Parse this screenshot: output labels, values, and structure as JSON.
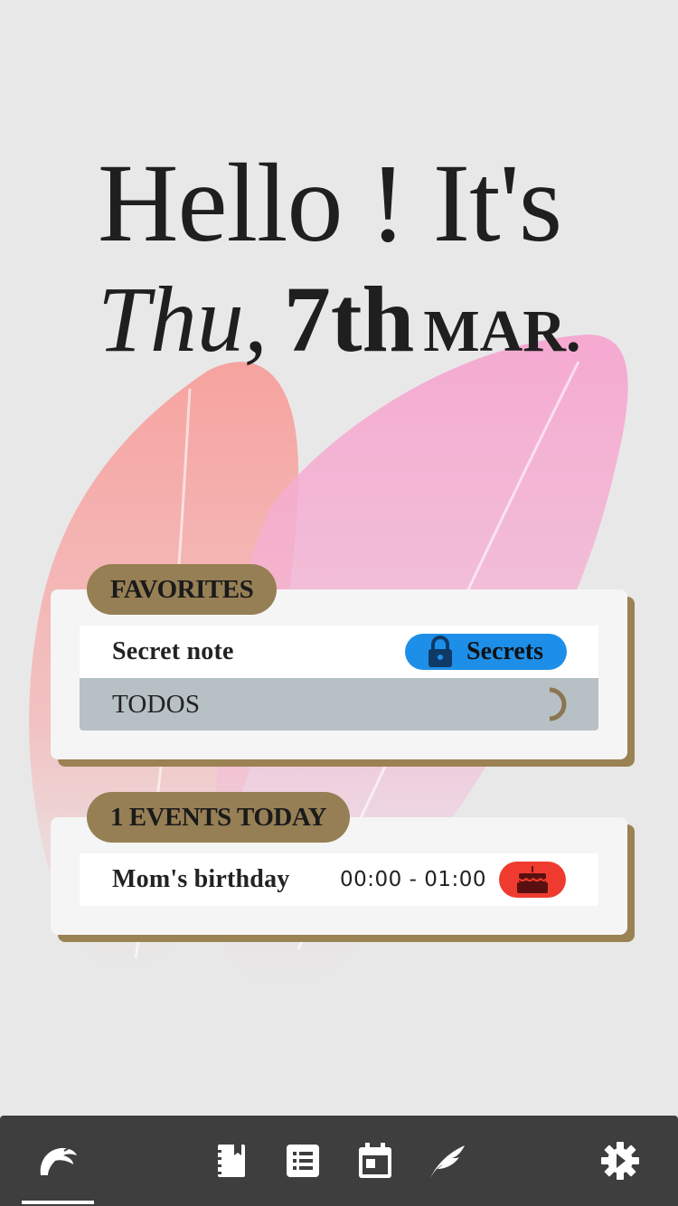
{
  "greeting": {
    "hello_text": "Hello ! It's",
    "day": "Thu,",
    "date": "7th",
    "month": "MAR."
  },
  "favorites": {
    "title": "FAVORITES",
    "items": [
      {
        "label": "Secret note",
        "tag": "Secrets",
        "tag_icon": "lock-icon",
        "tag_color": "#1e8fe8"
      },
      {
        "label": "TODOS",
        "indicator": "progress-ring-icon"
      }
    ]
  },
  "events": {
    "title": "1 EVENTS TODAY",
    "items": [
      {
        "label": "Mom's birthday",
        "time": "00:00 - 01:00",
        "icon": "cake-icon",
        "icon_color": "#ef3b2f"
      }
    ]
  },
  "nav": {
    "items": [
      {
        "icon": "bird-logo-icon",
        "active": true
      },
      {
        "icon": "notebook-icon"
      },
      {
        "icon": "list-icon"
      },
      {
        "icon": "calendar-icon"
      },
      {
        "icon": "feather-icon"
      },
      {
        "icon": "gear-icon"
      }
    ]
  },
  "colors": {
    "accent": "#967f55",
    "background": "#e8e8e8",
    "nav_background": "#3e3e3e"
  }
}
